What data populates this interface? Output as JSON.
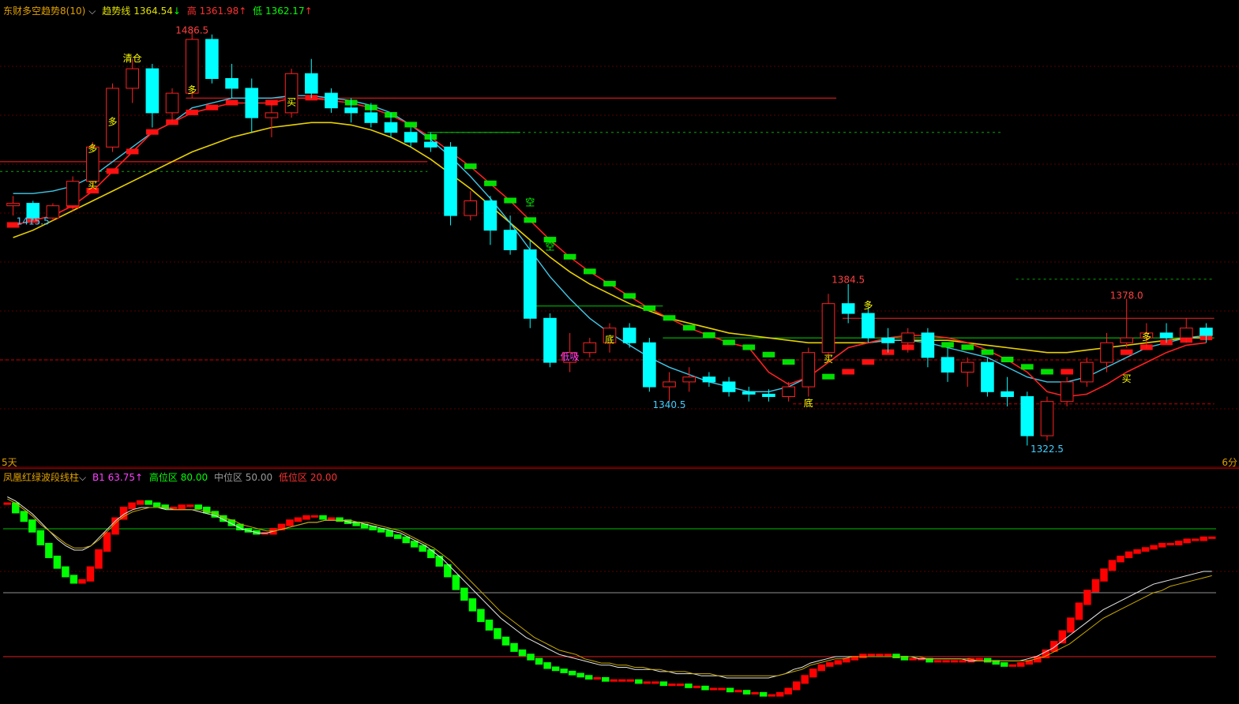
{
  "main": {
    "indicator_name": "东财多空趋势8(10)",
    "trend_label": "趋势线",
    "trend_value": "1364.54",
    "trend_arrow": "↓",
    "high_label": "高",
    "high_value": "1361.98",
    "high_arrow": "↑",
    "low_label": "低",
    "low_value": "1362.17",
    "low_arrow": "↑",
    "left_corner": "5天",
    "right_corner": "6分"
  },
  "sub": {
    "indicator_name": "凤凰红绿波段线柱",
    "b1_label": "B1",
    "b1_value": "63.75",
    "b1_arrow": "↑",
    "high_zone_label": "高位区",
    "high_zone_value": "80.00",
    "mid_zone_label": "中位区",
    "mid_zone_value": "50.00",
    "low_zone_label": "低位区",
    "low_zone_value": "20.00"
  },
  "colors": {
    "up": "#ff2020",
    "down": "#00ffff",
    "bull_bar": "#ff0000",
    "bear_bar": "#00ff00",
    "ma_yellow": "#e8d000",
    "ma_cyan": "#40c8e8",
    "ma_red": "#ff2020",
    "bg": "#000000"
  },
  "chart_data": [
    {
      "type": "candlestick",
      "ylim": [
        1315,
        1495
      ],
      "price_labels": [
        {
          "text": "1486.5",
          "bar": 9,
          "price": 1486.5,
          "pos": "above",
          "color": "#ff4040"
        },
        {
          "text": "1415.5",
          "bar": 1,
          "price": 1415.5,
          "pos": "below",
          "color": "#40d0ff"
        },
        {
          "text": "1384.5",
          "bar": 42,
          "price": 1384.5,
          "pos": "above",
          "color": "#ff4040"
        },
        {
          "text": "1340.5",
          "bar": 33,
          "price": 1340.5,
          "pos": "below",
          "color": "#40d0ff"
        },
        {
          "text": "1378.0",
          "bar": 56,
          "price": 1378.0,
          "pos": "above",
          "color": "#ff4040"
        },
        {
          "text": "1322.5",
          "bar": 52,
          "price": 1322.5,
          "pos": "below",
          "color": "#40d0ff"
        }
      ],
      "signals": [
        {
          "text": "清仓",
          "bar": 6,
          "price": 1477,
          "color": "#ffff00"
        },
        {
          "text": "多",
          "bar": 9,
          "price": 1464,
          "color": "#ffff00"
        },
        {
          "text": "多",
          "bar": 5,
          "price": 1451,
          "color": "#ffff00"
        },
        {
          "text": "多",
          "bar": 4,
          "price": 1440,
          "color": "#ffff00"
        },
        {
          "text": "买",
          "bar": 4,
          "price": 1425,
          "color": "#ffff00"
        },
        {
          "text": "买",
          "bar": 14,
          "price": 1459,
          "color": "#ffff00"
        },
        {
          "text": "空",
          "bar": 26,
          "price": 1418,
          "color": "#00ff00"
        },
        {
          "text": "空",
          "bar": 27,
          "price": 1400,
          "color": "#00ff00"
        },
        {
          "text": "低吸",
          "bar": 28,
          "price": 1355,
          "color": "#ff40ff"
        },
        {
          "text": "底",
          "bar": 30,
          "price": 1362,
          "color": "#ffff00"
        },
        {
          "text": "底",
          "bar": 40,
          "price": 1336,
          "color": "#ffff00"
        },
        {
          "text": "买",
          "bar": 41,
          "price": 1354,
          "color": "#ffff00"
        },
        {
          "text": "多",
          "bar": 43,
          "price": 1376,
          "color": "#ffff00"
        },
        {
          "text": "买",
          "bar": 56,
          "price": 1346,
          "color": "#ffff00"
        },
        {
          "text": "多",
          "bar": 57,
          "price": 1363,
          "color": "#ffff00"
        }
      ],
      "candles": [
        [
          1418,
          1422,
          1414,
          1419
        ],
        [
          1419,
          1420,
          1412,
          1413
        ],
        [
          1413,
          1419,
          1412,
          1418
        ],
        [
          1418,
          1430,
          1416,
          1428
        ],
        [
          1428,
          1444,
          1426,
          1442
        ],
        [
          1442,
          1468,
          1440,
          1466
        ],
        [
          1466,
          1478,
          1460,
          1474
        ],
        [
          1474,
          1476,
          1450,
          1456
        ],
        [
          1456,
          1466,
          1452,
          1464
        ],
        [
          1464,
          1490,
          1462,
          1486
        ],
        [
          1486,
          1488,
          1468,
          1470
        ],
        [
          1470,
          1476,
          1462,
          1466
        ],
        [
          1466,
          1470,
          1448,
          1454
        ],
        [
          1454,
          1460,
          1446,
          1456
        ],
        [
          1456,
          1474,
          1454,
          1472
        ],
        [
          1472,
          1478,
          1462,
          1464
        ],
        [
          1464,
          1466,
          1456,
          1458
        ],
        [
          1458,
          1462,
          1452,
          1456
        ],
        [
          1456,
          1460,
          1450,
          1452
        ],
        [
          1452,
          1456,
          1446,
          1448
        ],
        [
          1448,
          1450,
          1442,
          1444
        ],
        [
          1444,
          1448,
          1440,
          1442
        ],
        [
          1442,
          1444,
          1410,
          1414
        ],
        [
          1414,
          1424,
          1412,
          1420
        ],
        [
          1420,
          1422,
          1402,
          1408
        ],
        [
          1408,
          1414,
          1398,
          1400
        ],
        [
          1400,
          1404,
          1368,
          1372
        ],
        [
          1372,
          1374,
          1352,
          1354
        ],
        [
          1354,
          1366,
          1350,
          1358
        ],
        [
          1358,
          1364,
          1356,
          1362
        ],
        [
          1362,
          1370,
          1358,
          1368
        ],
        [
          1368,
          1370,
          1360,
          1362
        ],
        [
          1362,
          1364,
          1342,
          1344
        ],
        [
          1344,
          1350,
          1338,
          1346
        ],
        [
          1346,
          1352,
          1342,
          1348
        ],
        [
          1348,
          1350,
          1344,
          1346
        ],
        [
          1346,
          1348,
          1340,
          1342
        ],
        [
          1342,
          1344,
          1338,
          1341
        ],
        [
          1341,
          1343,
          1338,
          1340
        ],
        [
          1340,
          1346,
          1338,
          1344
        ],
        [
          1344,
          1360,
          1340,
          1358
        ],
        [
          1358,
          1382,
          1356,
          1378
        ],
        [
          1378,
          1386,
          1370,
          1374
        ],
        [
          1374,
          1376,
          1362,
          1364
        ],
        [
          1364,
          1368,
          1358,
          1362
        ],
        [
          1362,
          1368,
          1358,
          1366
        ],
        [
          1366,
          1368,
          1352,
          1356
        ],
        [
          1356,
          1360,
          1346,
          1350
        ],
        [
          1350,
          1356,
          1344,
          1354
        ],
        [
          1354,
          1356,
          1340,
          1342
        ],
        [
          1342,
          1348,
          1336,
          1340
        ],
        [
          1340,
          1342,
          1320,
          1324
        ],
        [
          1324,
          1340,
          1322,
          1338
        ],
        [
          1338,
          1348,
          1336,
          1346
        ],
        [
          1346,
          1356,
          1344,
          1354
        ],
        [
          1354,
          1366,
          1350,
          1362
        ],
        [
          1362,
          1380,
          1360,
          1364
        ],
        [
          1364,
          1370,
          1360,
          1366
        ],
        [
          1366,
          1370,
          1362,
          1364
        ],
        [
          1364,
          1372,
          1362,
          1368
        ],
        [
          1368,
          1370,
          1362,
          1365
        ]
      ],
      "ma_yellow": [
        1405,
        1408,
        1412,
        1416,
        1420,
        1424,
        1428,
        1432,
        1436,
        1440,
        1443,
        1446,
        1448,
        1450,
        1451,
        1452,
        1452,
        1451,
        1449,
        1446,
        1442,
        1437,
        1431,
        1425,
        1418,
        1411,
        1404,
        1397,
        1391,
        1386,
        1382,
        1378,
        1375,
        1372,
        1370,
        1368,
        1366,
        1365,
        1364,
        1363,
        1362,
        1362,
        1362,
        1362,
        1363,
        1363,
        1363,
        1363,
        1362,
        1361,
        1360,
        1359,
        1358,
        1358,
        1359,
        1360,
        1361,
        1362,
        1363,
        1364,
        1364
      ],
      "ma_cyan": [
        1423,
        1423,
        1424,
        1426,
        1430,
        1436,
        1442,
        1448,
        1452,
        1458,
        1460,
        1462,
        1462,
        1462,
        1463,
        1463,
        1462,
        1461,
        1459,
        1456,
        1451,
        1445,
        1438,
        1430,
        1421,
        1411,
        1400,
        1389,
        1380,
        1372,
        1366,
        1361,
        1356,
        1352,
        1349,
        1346,
        1344,
        1342,
        1342,
        1344,
        1348,
        1354,
        1360,
        1362,
        1363,
        1363,
        1362,
        1360,
        1358,
        1356,
        1352,
        1348,
        1346,
        1346,
        1348,
        1352,
        1356,
        1360,
        1362,
        1364,
        1365
      ],
      "ma_red": [
        1410,
        1412,
        1414,
        1418,
        1424,
        1432,
        1440,
        1448,
        1452,
        1456,
        1458,
        1460,
        1460,
        1460,
        1462,
        1462,
        1461,
        1460,
        1458,
        1455,
        1451,
        1446,
        1440,
        1434,
        1427,
        1420,
        1412,
        1404,
        1397,
        1391,
        1386,
        1381,
        1376,
        1372,
        1368,
        1365,
        1362,
        1360,
        1350,
        1345,
        1348,
        1354,
        1360,
        1362,
        1364,
        1365,
        1365,
        1364,
        1362,
        1359,
        1355,
        1350,
        1342,
        1340,
        1341,
        1345,
        1350,
        1354,
        1358,
        1361,
        1362
      ],
      "trend_line_green": [
        1410,
        1412,
        1414,
        1418,
        1424,
        1432,
        1440,
        1448,
        1452,
        1456,
        1458,
        1460,
        1460,
        1460,
        1462,
        1462,
        1461,
        1460,
        1458,
        1455,
        1451,
        1446,
        1440,
        1434,
        1427,
        1420,
        1412,
        1404,
        1397,
        1391,
        1386,
        1381,
        1376,
        1372,
        1368,
        1365,
        1362,
        1360,
        1357,
        1354,
        1350,
        1348,
        1350,
        1354,
        1358,
        1360,
        1362,
        1361,
        1360,
        1358,
        1355,
        1352,
        1350,
        1350,
        1352,
        1355,
        1358,
        1360,
        1362,
        1363,
        1364
      ]
    },
    {
      "type": "bar",
      "ylim": [
        0,
        100
      ],
      "levels": {
        "high": 80,
        "mid": 50,
        "low": 20
      },
      "values": [
        92,
        88,
        84,
        79,
        73,
        67,
        62,
        58,
        55,
        56,
        62,
        70,
        78,
        85,
        90,
        92,
        93,
        92,
        91,
        90,
        90,
        91,
        91,
        90,
        88,
        86,
        84,
        82,
        80,
        79,
        78,
        78,
        80,
        82,
        84,
        85,
        86,
        86,
        85,
        85,
        84,
        83,
        82,
        81,
        80,
        79,
        77,
        76,
        74,
        72,
        70,
        67,
        63,
        58,
        52,
        47,
        42,
        37,
        33,
        29,
        26,
        23,
        21,
        19,
        17,
        15,
        14,
        13,
        12,
        11,
        10,
        10,
        9,
        9,
        9,
        9,
        8,
        8,
        8,
        7,
        7,
        7,
        6,
        6,
        5,
        5,
        5,
        4,
        4,
        3,
        3,
        2,
        2,
        3,
        5,
        8,
        11,
        14,
        16,
        17,
        18,
        19,
        20,
        21,
        21,
        21,
        21,
        20,
        19,
        19,
        19,
        18,
        18,
        18,
        18,
        18,
        19,
        19,
        18,
        17,
        16,
        16,
        17,
        18,
        20,
        23,
        27,
        32,
        38,
        45,
        51,
        56,
        61,
        65,
        67,
        69,
        70,
        71,
        72,
        73,
        73,
        74,
        75,
        75,
        76,
        76
      ],
      "line_white": [
        95,
        93,
        90,
        87,
        83,
        79,
        75,
        72,
        70,
        70,
        72,
        76,
        80,
        84,
        87,
        89,
        90,
        90,
        90,
        89,
        89,
        89,
        89,
        88,
        87,
        86,
        84,
        82,
        80,
        79,
        78,
        78,
        79,
        80,
        81,
        82,
        83,
        83,
        84,
        84,
        84,
        83,
        83,
        82,
        81,
        80,
        79,
        78,
        76,
        74,
        72,
        69,
        66,
        62,
        58,
        54,
        50,
        46,
        42,
        38,
        35,
        32,
        29,
        27,
        25,
        23,
        21,
        20,
        19,
        18,
        17,
        16,
        16,
        15,
        15,
        14,
        14,
        14,
        13,
        13,
        12,
        12,
        12,
        11,
        11,
        11,
        10,
        10,
        10,
        10,
        10,
        10,
        11,
        12,
        14,
        15,
        17,
        18,
        19,
        20,
        20,
        20,
        20,
        20,
        20,
        20,
        20,
        20,
        20,
        19,
        19,
        19,
        19,
        19,
        19,
        18,
        18,
        18,
        18,
        18,
        18,
        18,
        19,
        20,
        22,
        24,
        27,
        30,
        33,
        36,
        39,
        42,
        44,
        46,
        48,
        50,
        52,
        54,
        55,
        56,
        57,
        58,
        59,
        60,
        60
      ],
      "line_yellow": [
        94,
        92,
        89,
        86,
        82,
        79,
        76,
        73,
        71,
        71,
        72,
        75,
        79,
        83,
        86,
        88,
        89,
        90,
        90,
        90,
        89,
        89,
        89,
        89,
        88,
        87,
        85,
        84,
        82,
        81,
        80,
        79,
        79,
        80,
        81,
        82,
        83,
        83,
        84,
        84,
        84,
        84,
        83,
        83,
        82,
        81,
        80,
        79,
        77,
        75,
        73,
        71,
        68,
        65,
        61,
        57,
        53,
        49,
        45,
        41,
        38,
        35,
        32,
        29,
        27,
        25,
        23,
        22,
        21,
        19,
        18,
        17,
        17,
        16,
        16,
        15,
        15,
        14,
        14,
        13,
        13,
        13,
        12,
        12,
        12,
        11,
        11,
        11,
        11,
        11,
        11,
        11,
        11,
        12,
        13,
        14,
        16,
        17,
        18,
        19,
        19,
        20,
        20,
        20,
        20,
        20,
        20,
        20,
        20,
        20,
        19,
        19,
        19,
        19,
        19,
        19,
        18,
        18,
        18,
        18,
        18,
        18,
        18,
        19,
        20,
        22,
        24,
        26,
        29,
        32,
        35,
        38,
        40,
        42,
        44,
        46,
        48,
        50,
        51,
        53,
        54,
        55,
        56,
        57,
        58
      ]
    }
  ]
}
